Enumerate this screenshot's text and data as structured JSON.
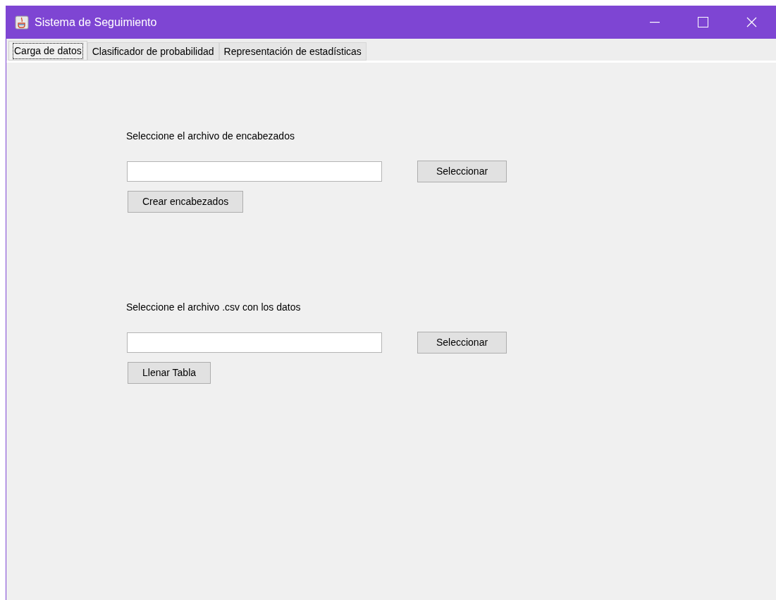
{
  "window": {
    "title": "Sistema de Seguimiento"
  },
  "tabs": [
    {
      "label": "Carga de datos",
      "selected": true
    },
    {
      "label": "Clasificador de probabilidad",
      "selected": false
    },
    {
      "label": "Representación de estadísticas",
      "selected": false
    }
  ],
  "sections": [
    {
      "label": "Seleccione el archivo de encabezados",
      "browse_button": "Seleccionar",
      "action_button": "Crear encabezados"
    },
    {
      "label": "Seleccione el archivo .csv con los datos",
      "browse_button": "Seleccionar",
      "action_button": "Llenar Tabla"
    }
  ]
}
